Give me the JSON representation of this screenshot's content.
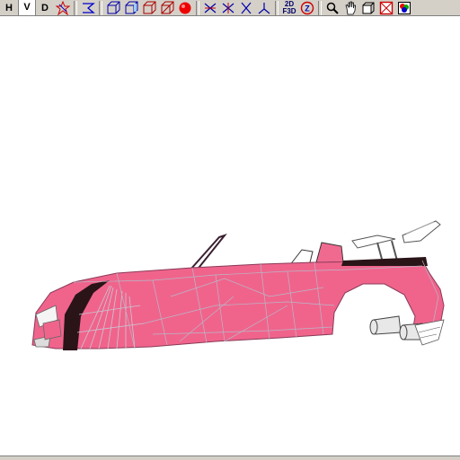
{
  "toolbar": {
    "view_buttons": [
      "H",
      "V",
      "D"
    ],
    "active_view": "V",
    "icons": [
      "star-tool-icon",
      "transform-icon",
      "cube-front-icon",
      "cube-side-icon",
      "cube-top-icon",
      "cube-perspective-icon",
      "sphere-render-icon",
      "axis-x-icon",
      "axis-y-icon",
      "axis-z-icon",
      "axis-free-icon",
      "toggle-2d-3d-icon",
      "zoom-extents-icon",
      "zoom-icon",
      "pan-icon",
      "box-icon",
      "frame-icon",
      "color-icon"
    ],
    "mode_label": "2D\nF3D"
  },
  "viewport": {
    "model": "car-wireframe",
    "body_color": "#f0648c",
    "wire_color": "#b8b8c8",
    "dark_color": "#2a1418"
  }
}
